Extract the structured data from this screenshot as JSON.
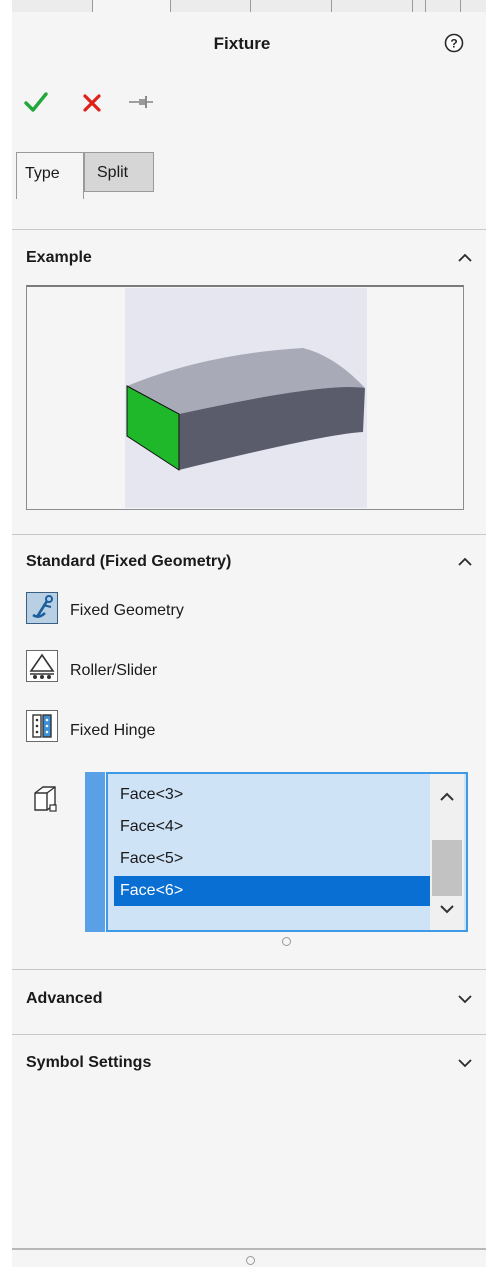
{
  "header": {
    "title": "Fixture",
    "help_icon": "help-circle-icon"
  },
  "actions": {
    "ok_icon": "green-check-icon",
    "cancel_icon": "red-x-icon",
    "pin_icon": "pushpin-icon",
    "ok_color": "#22a83a",
    "cancel_color": "#e0201a"
  },
  "tabs": [
    {
      "label": "Type",
      "active": true
    },
    {
      "label": "Split",
      "active": false
    }
  ],
  "sections": {
    "example": {
      "title": "Example",
      "expanded": true
    },
    "standard": {
      "title": "Standard (Fixed Geometry)",
      "expanded": true,
      "options": [
        {
          "label": "Fixed Geometry",
          "icon": "anchor-icon",
          "selected": true
        },
        {
          "label": "Roller/Slider",
          "icon": "roller-slider-icon",
          "selected": false
        },
        {
          "label": "Fixed Hinge",
          "icon": "hinge-icon",
          "selected": false
        }
      ],
      "face_list": {
        "icon": "face-selection-icon",
        "items": [
          "Face<3>",
          "Face<4>",
          "Face<5>",
          "Face<6>"
        ],
        "selected_index": 3
      }
    },
    "advanced": {
      "title": "Advanced",
      "expanded": false
    },
    "symbol": {
      "title": "Symbol Settings",
      "expanded": false
    }
  }
}
